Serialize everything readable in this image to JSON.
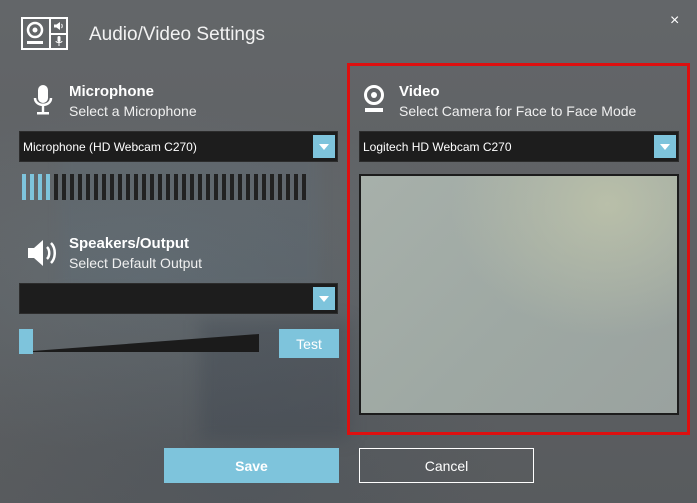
{
  "window": {
    "title": "Audio/Video Settings",
    "close_glyph": "×"
  },
  "microphone": {
    "icon": "microphone-icon",
    "title": "Microphone",
    "subtitle": "Select a Microphone",
    "selected": "Microphone (HD Webcam C270)",
    "level_active_bars": 4,
    "level_total_bars": 36
  },
  "speakers": {
    "icon": "speaker-icon",
    "title": "Speakers/Output",
    "subtitle": "Select Default Output",
    "selected": "",
    "volume_fraction": 0.0,
    "test_label": "Test"
  },
  "video": {
    "icon": "webcam-icon",
    "title": "Video",
    "subtitle": "Select Camera for Face to Face Mode",
    "selected": "Logitech HD Webcam C270"
  },
  "footer": {
    "save_label": "Save",
    "cancel_label": "Cancel"
  },
  "colors": {
    "accent": "#7ec4dc",
    "highlight_border": "#dd1010",
    "dropdown_bg": "#1d1d1d"
  }
}
